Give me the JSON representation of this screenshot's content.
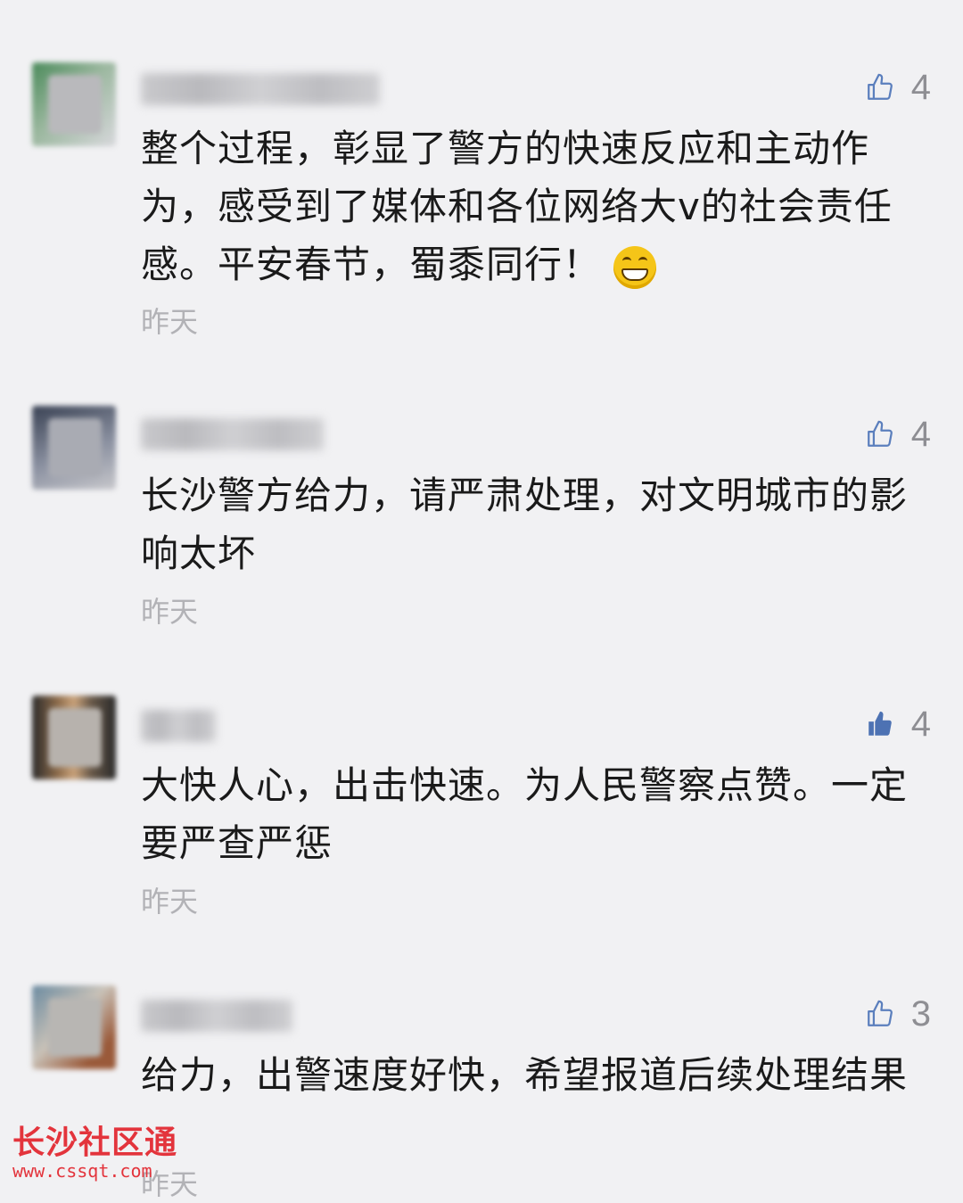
{
  "comments": [
    {
      "text": "整个过程，彰显了警方的快速反应和主动作为，感受到了媒体和各位网络大v的社会责任感。平安春节，蜀黍同行！",
      "time": "昨天",
      "likes": "4",
      "liked": false,
      "emoji": "grinning-face-emoji"
    },
    {
      "text": "长沙警方给力，请严肃处理，对文明城市的影响太坏",
      "time": "昨天",
      "likes": "4",
      "liked": false
    },
    {
      "text": "大快人心，出击快速。为人民警察点赞。一定要严查严惩",
      "time": "昨天",
      "likes": "4",
      "liked": true
    },
    {
      "text": "给力，出警速度好快，希望报道后续处理结果",
      "time": "昨天",
      "likes": "3",
      "liked": false
    }
  ],
  "watermark": {
    "title": "长沙社区通",
    "url": "www.cssqt.com"
  },
  "colors": {
    "background": "#f1f1f3",
    "like_accent": "#5b7fbd",
    "watermark": "#e3343c"
  }
}
